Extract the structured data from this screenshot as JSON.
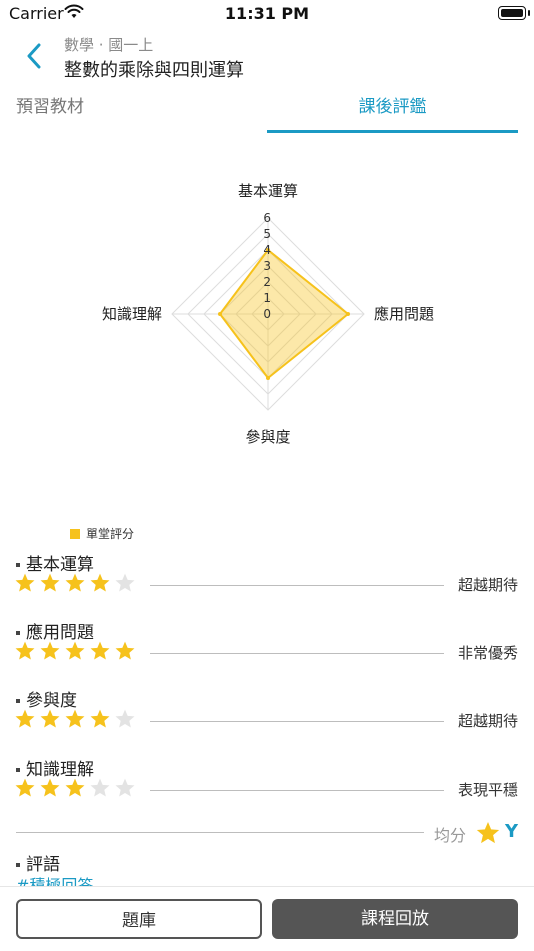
{
  "status_bar": {
    "carrier": "Carrier",
    "time": "11:31 PM"
  },
  "header": {
    "subject": "數學 · 國一上",
    "title": "整數的乘除與四則運算"
  },
  "tabs": [
    {
      "label": "預習教材",
      "active": false
    },
    {
      "label": "課後評鑑",
      "active": true
    }
  ],
  "chart_data": {
    "type": "radar",
    "axes": [
      "基本運算",
      "應用問題",
      "參與度",
      "知識理解"
    ],
    "scale_ticks": [
      "0",
      "1",
      "2",
      "3",
      "4",
      "5",
      "6"
    ],
    "range": [
      0,
      6
    ],
    "series": [
      {
        "name": "單堂評分",
        "values": [
          4,
          5,
          4,
          3
        ]
      }
    ],
    "colors": {
      "fill": "#f6c21c",
      "grid": "#dddddd"
    }
  },
  "ratings": [
    {
      "label": "基本運算",
      "stars": 4,
      "level": "超越期待"
    },
    {
      "label": "應用問題",
      "stars": 5,
      "level": "非常優秀"
    },
    {
      "label": "參與度",
      "stars": 4,
      "level": "超越期待"
    },
    {
      "label": "知識理解",
      "stars": 3,
      "level": "表現平穩"
    }
  ],
  "average": {
    "label": "均分",
    "value": "Y"
  },
  "comment": {
    "title": "評語",
    "tag": "#積極回答"
  },
  "buttons": {
    "question_bank": "題庫",
    "course_replay": "課程回放"
  },
  "colors": {
    "accent": "#1b9ac4",
    "star_on": "#f6c21c",
    "star_off": "#e3e3e3"
  }
}
